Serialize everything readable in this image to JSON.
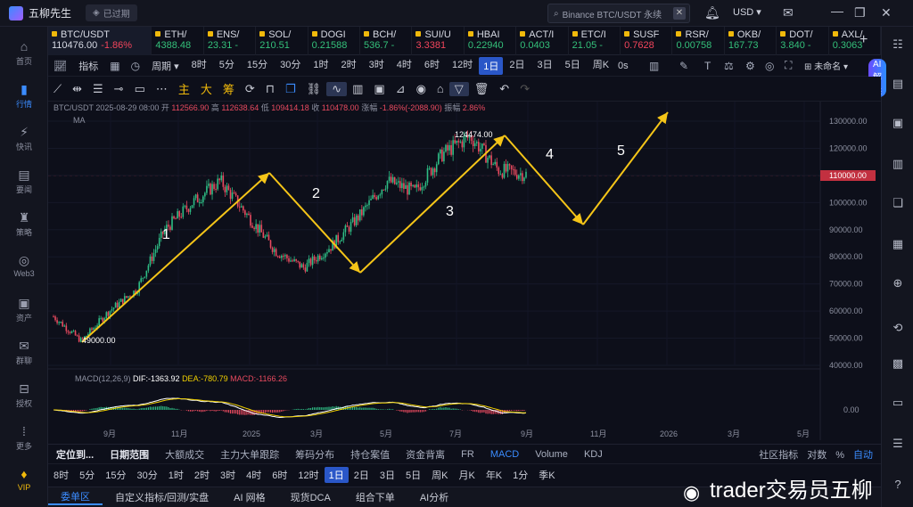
{
  "app": {
    "title": "五柳先生",
    "expired_label": "已过期"
  },
  "search": {
    "placeholder": "Binance BTC/USDT 永续"
  },
  "currency": "USD",
  "left_nav": [
    {
      "label": "首页",
      "icon": "home-icon"
    },
    {
      "label": "行情",
      "icon": "market-icon",
      "active": true
    },
    {
      "label": "快讯",
      "icon": "flash-news-icon"
    },
    {
      "label": "要闻",
      "icon": "news-icon"
    },
    {
      "label": "策略",
      "icon": "strategy-icon"
    },
    {
      "label": "Web3",
      "icon": "web3-icon"
    },
    {
      "label": "资产",
      "icon": "assets-icon"
    },
    {
      "label": "群聊",
      "icon": "chat-icon"
    },
    {
      "label": "授权",
      "icon": "authorize-icon"
    },
    {
      "label": "更多",
      "icon": "more-icon"
    },
    {
      "label": "VIP",
      "icon": "vip-icon",
      "vip": true
    }
  ],
  "tickers": [
    {
      "name": "BTC/USDT",
      "price": "110476.00",
      "change": "-1.86%",
      "dir": "down"
    },
    {
      "name": "ETH/",
      "price": "4388.48",
      "dir": "up"
    },
    {
      "name": "ENS/",
      "price": "23.31 -",
      "dir": "up"
    },
    {
      "name": "SOL/",
      "price": "210.51",
      "dir": "up"
    },
    {
      "name": "DOGI",
      "price": "0.21588",
      "dir": "up"
    },
    {
      "name": "BCH/",
      "price": "536.7 -",
      "dir": "up"
    },
    {
      "name": "SUI/U",
      "price": "3.3381",
      "dir": "down"
    },
    {
      "name": "HBAI",
      "price": "0.22940",
      "dir": "up"
    },
    {
      "name": "ACT/I",
      "price": "0.0403",
      "dir": "up"
    },
    {
      "name": "ETC/I",
      "price": "21.05 -",
      "dir": "up"
    },
    {
      "name": "SUSF",
      "price": "0.7628",
      "dir": "down"
    },
    {
      "name": "RSR/",
      "price": "0.00758",
      "dir": "up"
    },
    {
      "name": "OKB/",
      "price": "167.73",
      "dir": "up"
    },
    {
      "name": "DOT/",
      "price": "3.840 -",
      "dir": "up"
    },
    {
      "name": "AXL/",
      "price": "0.3063",
      "dir": "up"
    }
  ],
  "toolbar": {
    "indicator_label": "指标",
    "period_label": "周期",
    "intervals": [
      "8时",
      "5分",
      "15分",
      "30分",
      "1时",
      "2时",
      "3时",
      "4时",
      "6时",
      "12时",
      "1日",
      "2日",
      "3日",
      "5日",
      "周K"
    ],
    "active_interval": "1日",
    "seconds_label": "0s",
    "unnamed_label": "未命名",
    "ai_label": "AI解读",
    "draw_labels": [
      "主",
      "大",
      "筹"
    ]
  },
  "chart": {
    "info": {
      "symbol": "BTC/USDT",
      "date": "2025-08-29 08:00",
      "open_label": "开",
      "open": "112566.90",
      "high_label": "高",
      "high": "112638.64",
      "low_label": "低",
      "low": "109414.18",
      "close_label": "收",
      "close": "110478.00",
      "change_label": "涨幅",
      "change": "-1.86%(-2088.90)",
      "amplitude_label": "振幅",
      "amplitude": "2.86%"
    },
    "ma_label": "MA",
    "macd_info": {
      "label": "MACD(12,26,9)",
      "dif_label": "DIF:",
      "dif": "-1363.92",
      "dea_label": "DEA:",
      "dea": "-780.79",
      "macd_label": "MACD:",
      "macd": "-1166.26"
    },
    "y_ticks": [
      "130000.00",
      "120000.00",
      "110000.00",
      "100000.00",
      "90000.00",
      "80000.00",
      "70000.00",
      "60000.00",
      "50000.00",
      "40000.00"
    ],
    "macd_zero": "0.00",
    "x_ticks": [
      "9月",
      "11月",
      "2025",
      "3月",
      "5月",
      "7月",
      "9月",
      "11月",
      "2026",
      "3月",
      "5月"
    ],
    "annotations": {
      "low_price": "49000.00",
      "high_price": "124474.00",
      "wave1": "1",
      "wave2": "2",
      "wave3": "3",
      "wave4": "4",
      "wave5": "5"
    },
    "crosshair_price": "110000.00"
  },
  "chart_data": {
    "type": "line",
    "title": "BTC/USDT",
    "ylim": [
      40000,
      130000
    ],
    "series": [
      {
        "name": "BTC/USDT",
        "points": [
          [
            0,
            58000
          ],
          [
            1,
            49000
          ],
          [
            2,
            60000
          ],
          [
            3,
            68000
          ],
          [
            4,
            90000
          ],
          [
            5,
            100000
          ],
          [
            6,
            108000
          ],
          [
            7,
            95000
          ],
          [
            8,
            82000
          ],
          [
            9,
            76000
          ],
          [
            10,
            84000
          ],
          [
            11,
            95000
          ],
          [
            12,
            108000
          ],
          [
            13,
            104000
          ],
          [
            14,
            118000
          ],
          [
            15,
            124474
          ],
          [
            16,
            112000
          ],
          [
            17,
            110476
          ]
        ]
      }
    ]
  },
  "bottom": {
    "tabs": [
      "定位到...",
      "日期范围",
      "大额成交",
      "主力大单跟踪",
      "筹码分布",
      "持仓案值",
      "资金背离",
      "FR",
      "MACD",
      "Volume",
      "KDJ"
    ],
    "active_tab": "MACD",
    "right_items": [
      "社区指标",
      "对数",
      "%",
      "自动"
    ],
    "intervals": [
      "8时",
      "5分",
      "15分",
      "30分",
      "1时",
      "2时",
      "3时",
      "4时",
      "6时",
      "12时",
      "1日",
      "2日",
      "3日",
      "5日",
      "周K",
      "月K",
      "年K",
      "1分",
      "季K"
    ],
    "active_interval": "1日",
    "panels": [
      "委单区",
      "自定义指标/回测/实盘",
      "AI 网格",
      "现货DCA",
      "组合下单",
      "AI分析"
    ],
    "active_panel": "委单区"
  },
  "watermark": "trader交易员五柳"
}
